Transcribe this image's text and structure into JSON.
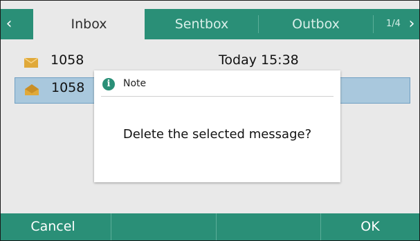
{
  "tabs": {
    "left_arrow": "‹",
    "right_arrow": "›",
    "items": [
      {
        "label": "Inbox",
        "active": true
      },
      {
        "label": "Sentbox",
        "active": false
      },
      {
        "label": "Outbox",
        "active": false
      }
    ],
    "page_indicator": "1/4"
  },
  "messages": [
    {
      "number": "1058",
      "time": "Today 15:38",
      "icon": "envelope-closed-icon",
      "selected": false
    },
    {
      "number": "1058",
      "time": "",
      "icon": "envelope-open-icon",
      "selected": true
    }
  ],
  "dialog": {
    "icon": "info-icon",
    "title": "Note",
    "message": "Delete the selected message?"
  },
  "softkeys": {
    "cancel": "Cancel",
    "key2": "",
    "key3": "",
    "ok": "OK"
  },
  "colors": {
    "accent": "#2a8f77",
    "selection": "#a9c8dd",
    "envelope": "#e0a93a"
  }
}
